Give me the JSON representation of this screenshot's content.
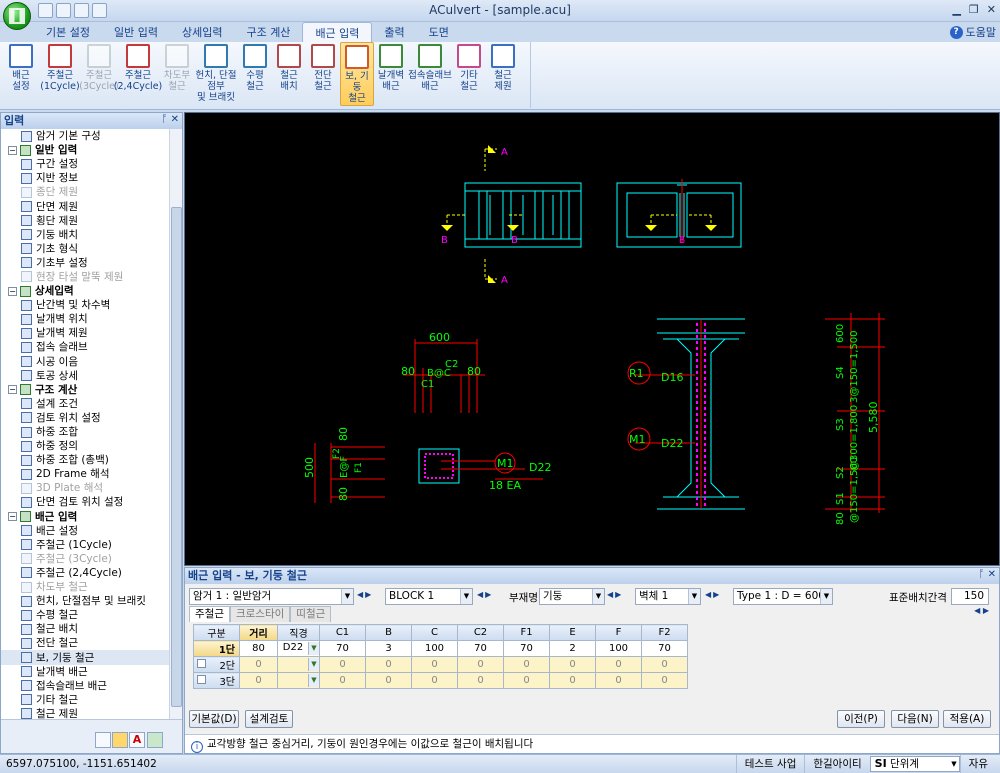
{
  "window": {
    "title": "ACulvert - [sample.acu]"
  },
  "ribbon_tabs": [
    "기본 설정",
    "일반 입력",
    "상세입력",
    "구조 계산",
    "배근 입력",
    "출력",
    "도면"
  ],
  "active_tab": 4,
  "help_label": "도움말",
  "ribbon_buttons": [
    {
      "label": "배근\n설정",
      "state": "normal"
    },
    {
      "label": "주철근\n(1Cycle)",
      "state": "normal"
    },
    {
      "label": "주철근\n(3Cycle)",
      "state": "disabled"
    },
    {
      "label": "주철근\n(2,4Cycle)",
      "state": "normal"
    },
    {
      "label": "차도부\n철근",
      "state": "disabled"
    },
    {
      "label": "헌치, 단절점부\n및 브래킷",
      "state": "normal"
    },
    {
      "label": "수평\n철근",
      "state": "normal"
    },
    {
      "label": "철근\n배치",
      "state": "normal"
    },
    {
      "label": "전단\n철근",
      "state": "normal"
    },
    {
      "label": "보, 기둥\n철근",
      "state": "selected"
    },
    {
      "label": "날개벽\n배근",
      "state": "normal"
    },
    {
      "label": "접속슬래브\n배근",
      "state": "normal"
    },
    {
      "label": "기타\n철근",
      "state": "normal"
    },
    {
      "label": "철근\n제원",
      "state": "normal"
    }
  ],
  "left_panel": {
    "title": "입력",
    "items": [
      {
        "label": "암거 기본 구성",
        "level": 1,
        "state": "normal"
      },
      {
        "label": "일반 입력",
        "level": 0,
        "state": "group"
      },
      {
        "label": "구간 설정",
        "level": 1,
        "state": "normal"
      },
      {
        "label": "지반 정보",
        "level": 1,
        "state": "normal"
      },
      {
        "label": "종단 제원",
        "level": 1,
        "state": "disabled"
      },
      {
        "label": "단면 제원",
        "level": 1,
        "state": "normal"
      },
      {
        "label": "횡단 제원",
        "level": 1,
        "state": "normal"
      },
      {
        "label": "기둥 배치",
        "level": 1,
        "state": "normal"
      },
      {
        "label": "기초 형식",
        "level": 1,
        "state": "normal"
      },
      {
        "label": "기초부 설정",
        "level": 1,
        "state": "normal"
      },
      {
        "label": "현장 타설 말뚝 제원",
        "level": 1,
        "state": "disabled"
      },
      {
        "label": "상세입력",
        "level": 0,
        "state": "group"
      },
      {
        "label": "난간벽 및 차수벽",
        "level": 1,
        "state": "normal"
      },
      {
        "label": "날개벽 위치",
        "level": 1,
        "state": "normal"
      },
      {
        "label": "날개벽 제원",
        "level": 1,
        "state": "normal"
      },
      {
        "label": "접속 슬래브",
        "level": 1,
        "state": "normal"
      },
      {
        "label": "시공 이음",
        "level": 1,
        "state": "normal"
      },
      {
        "label": "토공 상세",
        "level": 1,
        "state": "normal"
      },
      {
        "label": "구조 계산",
        "level": 0,
        "state": "group"
      },
      {
        "label": "설계 조건",
        "level": 1,
        "state": "normal"
      },
      {
        "label": "검토 위치 설정",
        "level": 1,
        "state": "normal"
      },
      {
        "label": "하중 조합",
        "level": 1,
        "state": "normal"
      },
      {
        "label": "하중 정의",
        "level": 1,
        "state": "normal"
      },
      {
        "label": "하중 조합 (총백)",
        "level": 1,
        "state": "normal"
      },
      {
        "label": "2D Frame 해석",
        "level": 1,
        "state": "normal"
      },
      {
        "label": "3D Plate 해석",
        "level": 1,
        "state": "disabled"
      },
      {
        "label": "단면 검토 위치 설정",
        "level": 1,
        "state": "normal"
      },
      {
        "label": "배근 입력",
        "level": 0,
        "state": "group"
      },
      {
        "label": "배근 설정",
        "level": 1,
        "state": "normal"
      },
      {
        "label": "주철근 (1Cycle)",
        "level": 1,
        "state": "normal"
      },
      {
        "label": "주철근 (3Cycle)",
        "level": 1,
        "state": "disabled"
      },
      {
        "label": "주철근 (2,4Cycle)",
        "level": 1,
        "state": "normal"
      },
      {
        "label": "차도부 철근",
        "level": 1,
        "state": "disabled"
      },
      {
        "label": "헌치, 단절점부 및 브래킷",
        "level": 1,
        "state": "normal"
      },
      {
        "label": "수평 철근",
        "level": 1,
        "state": "normal"
      },
      {
        "label": "철근 배치",
        "level": 1,
        "state": "normal"
      },
      {
        "label": "전단 철근",
        "level": 1,
        "state": "normal"
      },
      {
        "label": "보, 기둥 철근",
        "level": 1,
        "state": "selected"
      },
      {
        "label": "날개벽 배근",
        "level": 1,
        "state": "normal"
      },
      {
        "label": "접속슬래브 배근",
        "level": 1,
        "state": "normal"
      },
      {
        "label": "기타 철근",
        "level": 1,
        "state": "normal"
      },
      {
        "label": "철근 제원",
        "level": 1,
        "state": "normal"
      }
    ]
  },
  "drawing": {
    "plan_section_labels": [
      "A",
      "A",
      "B",
      "B",
      "B"
    ],
    "beam_dims": {
      "width": "600",
      "left": "80",
      "right": "80",
      "c1": "C1",
      "c2": "C2",
      "b": "B@C"
    },
    "column_dims": {
      "left": "80",
      "right": "80",
      "mid": "500",
      "e": "E@F",
      "f1": "F1",
      "f2": "F2"
    },
    "m1_label": "M1",
    "m1_bar": "D22",
    "m1_count": "18 EA",
    "r1_label": "R1",
    "r1_bar": "D16",
    "m1b_label": "M1",
    "m1b_bar": "D22",
    "stirrup_dims": {
      "top": "600",
      "s4": "S4",
      "s3": "S3",
      "s2": "S2",
      "s1": "S1",
      "bottom": "80",
      "mid1": "3@150=1,500",
      "mid2": "@300=1,800",
      "mid3": "@150=1,500",
      "total": "5,580"
    }
  },
  "bottom_panel": {
    "title": "배근 입력 - 보, 기둥 철근",
    "culvert_select": "암거 1 : 일반암거",
    "block_select": "BLOCK  1",
    "member_label": "부재명",
    "member_select": "기둥",
    "wall_select": "벽체 1",
    "type_select": "Type 1 : D = 600",
    "spacing_label": "표준배치간격",
    "spacing_value": "150",
    "subtabs": [
      "주철근",
      "크로스타이",
      "띠철근"
    ],
    "grid": {
      "headers": [
        "구분",
        "거리",
        "직경",
        "C1",
        "B",
        "C",
        "C2",
        "F1",
        "E",
        "F",
        "F2"
      ],
      "rows": [
        {
          "name": "1단",
          "values": [
            "80",
            "D22",
            "70",
            "3",
            "100",
            "70",
            "70",
            "2",
            "100",
            "70"
          ]
        },
        {
          "name": "2단",
          "values": [
            "0",
            "",
            "0",
            "0",
            "0",
            "0",
            "0",
            "0",
            "0",
            "0"
          ]
        },
        {
          "name": "3단",
          "values": [
            "0",
            "",
            "0",
            "0",
            "0",
            "0",
            "0",
            "0",
            "0",
            "0"
          ]
        }
      ]
    },
    "buttons": {
      "default": "기본값(D)",
      "check": "설계검토",
      "prev": "이전(P)",
      "next": "다음(N)",
      "apply": "적용(A)"
    },
    "info": "교각방향 철근 중심거리, 기둥이 원인경우에는 이값으로 철근이 배치됩니다"
  },
  "status": {
    "coords": "6597.075100,   -1151.651402",
    "project": "테스트 사업",
    "company": "한길아이티",
    "unit_prefix": "SI",
    "unit": "단위계",
    "mode": "자유"
  },
  "colors": {
    "cad_bg": "#000000",
    "cad_cyan": "#00ffff",
    "cad_red": "#ff0000",
    "cad_green": "#00ff00",
    "cad_yellow": "#ffff00",
    "cad_magenta": "#ff00ff",
    "cad_white": "#ffffff"
  }
}
